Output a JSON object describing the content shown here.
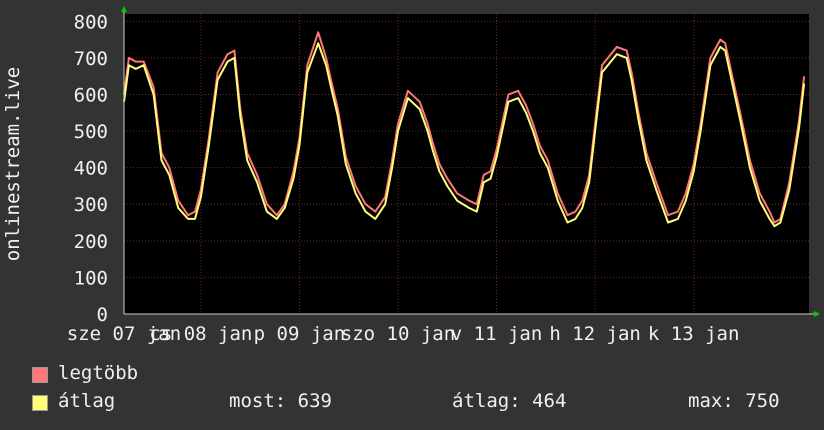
{
  "chart_data": {
    "type": "line",
    "ylabel": "onlinestream.live",
    "ylim": [
      0,
      820
    ],
    "yticks": [
      0,
      100,
      200,
      300,
      400,
      500,
      600,
      700,
      800
    ],
    "xlim": [
      0,
      6.95
    ],
    "x_tick_labels": [
      {
        "x": 0,
        "label": "sze 07 jan"
      },
      {
        "x": 0.78,
        "label": "cs 08 jan"
      },
      {
        "x": 1.78,
        "label": "p 09 jan"
      },
      {
        "x": 2.78,
        "label": "szo 10 jan"
      },
      {
        "x": 3.78,
        "label": "v 11 jan"
      },
      {
        "x": 4.78,
        "label": "h 12 jan"
      },
      {
        "x": 5.78,
        "label": "k 13 jan"
      }
    ],
    "grid": true,
    "series": [
      {
        "name": "legtöbb",
        "color": "#ff7777",
        "x": [
          0,
          0.05,
          0.12,
          0.2,
          0.3,
          0.38,
          0.46,
          0.55,
          0.65,
          0.72,
          0.78,
          0.86,
          0.95,
          1.05,
          1.12,
          1.18,
          1.25,
          1.35,
          1.45,
          1.55,
          1.63,
          1.72,
          1.78,
          1.86,
          1.97,
          2.05,
          2.1,
          2.17,
          2.25,
          2.35,
          2.45,
          2.55,
          2.65,
          2.72,
          2.78,
          2.88,
          3.0,
          3.08,
          3.13,
          3.2,
          3.28,
          3.38,
          3.5,
          3.58,
          3.65,
          3.72,
          3.78,
          3.9,
          4.0,
          4.08,
          4.15,
          4.22,
          4.3,
          4.4,
          4.5,
          4.58,
          4.65,
          4.72,
          4.78,
          4.85,
          5.0,
          5.1,
          5.15,
          5.22,
          5.3,
          5.4,
          5.52,
          5.62,
          5.7,
          5.78,
          5.85,
          5.95,
          6.05,
          6.1,
          6.18,
          6.26,
          6.35,
          6.45,
          6.55,
          6.6,
          6.66,
          6.75,
          6.85,
          6.9
        ],
        "values": [
          600,
          700,
          690,
          690,
          620,
          440,
          400,
          310,
          270,
          280,
          340,
          480,
          660,
          710,
          720,
          560,
          440,
          380,
          300,
          270,
          300,
          390,
          480,
          680,
          770,
          700,
          640,
          560,
          430,
          350,
          300,
          280,
          320,
          420,
          520,
          610,
          580,
          520,
          470,
          410,
          370,
          330,
          310,
          300,
          380,
          390,
          450,
          600,
          610,
          570,
          520,
          460,
          420,
          330,
          270,
          280,
          310,
          380,
          520,
          680,
          730,
          720,
          660,
          550,
          440,
          360,
          270,
          280,
          330,
          410,
          520,
          700,
          750,
          740,
          640,
          540,
          420,
          330,
          280,
          250,
          260,
          360,
          530,
          650
        ]
      },
      {
        "name": "átlag",
        "color": "#ffff77",
        "x": [
          0,
          0.05,
          0.12,
          0.2,
          0.3,
          0.38,
          0.46,
          0.55,
          0.65,
          0.72,
          0.78,
          0.86,
          0.95,
          1.05,
          1.12,
          1.18,
          1.25,
          1.35,
          1.45,
          1.55,
          1.63,
          1.72,
          1.78,
          1.86,
          1.97,
          2.05,
          2.1,
          2.17,
          2.25,
          2.35,
          2.45,
          2.55,
          2.65,
          2.72,
          2.78,
          2.88,
          3.0,
          3.08,
          3.13,
          3.2,
          3.28,
          3.38,
          3.5,
          3.58,
          3.65,
          3.72,
          3.78,
          3.9,
          4.0,
          4.08,
          4.15,
          4.22,
          4.3,
          4.4,
          4.5,
          4.58,
          4.65,
          4.72,
          4.78,
          4.85,
          5.0,
          5.1,
          5.15,
          5.22,
          5.3,
          5.4,
          5.52,
          5.62,
          5.7,
          5.78,
          5.85,
          5.95,
          6.05,
          6.1,
          6.18,
          6.26,
          6.35,
          6.45,
          6.55,
          6.6,
          6.66,
          6.75,
          6.85,
          6.9
        ],
        "values": [
          580,
          680,
          670,
          680,
          600,
          420,
          380,
          290,
          260,
          260,
          320,
          460,
          640,
          690,
          700,
          540,
          420,
          360,
          280,
          260,
          290,
          370,
          460,
          660,
          740,
          680,
          620,
          540,
          410,
          330,
          280,
          260,
          300,
          400,
          500,
          590,
          560,
          500,
          450,
          390,
          350,
          310,
          290,
          280,
          360,
          370,
          430,
          580,
          590,
          550,
          500,
          440,
          400,
          310,
          250,
          260,
          290,
          360,
          500,
          660,
          710,
          700,
          640,
          530,
          420,
          340,
          250,
          260,
          310,
          390,
          500,
          680,
          730,
          720,
          620,
          520,
          400,
          310,
          260,
          240,
          250,
          340,
          510,
          630
        ]
      }
    ]
  },
  "legend": {
    "max_label": "legtöbb",
    "avg_label": "átlag",
    "current": "most: 639",
    "average": "átlag: 464",
    "maximum": "max: 750"
  }
}
